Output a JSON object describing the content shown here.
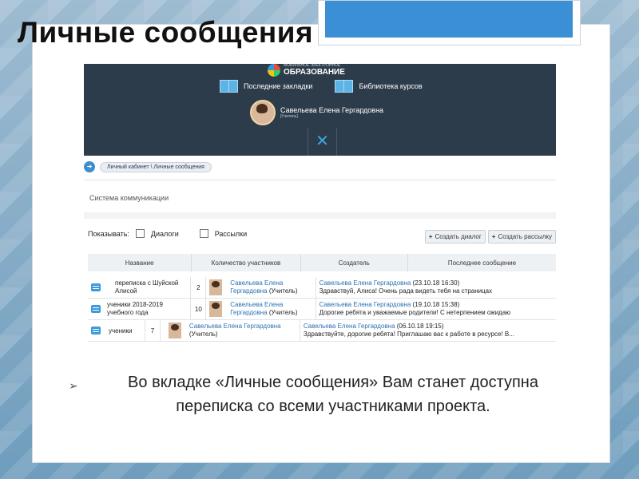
{
  "slide": {
    "title": "Личные сообщения",
    "bullet": "Во вкладке «Личные сообщения» Вам станет доступна переписка со всеми участниками проекта."
  },
  "app": {
    "logo_small": "МОБИЛЬНОЕ ЭЛЕКТРОННОЕ",
    "logo_main": "ОБРАЗОВАНИЕ",
    "nav": [
      {
        "label": "Последние закладки",
        "icon": "bookmarks-icon"
      },
      {
        "label": "Библиотека курсов",
        "icon": "library-icon"
      }
    ],
    "user": {
      "name": "Савельева Елена Гергардовна",
      "role": "[Учитель]"
    },
    "close_symbol": "✕",
    "breadcrumb": [
      "Личный кабинет",
      "Личные сообщения"
    ],
    "section_title": "Система коммуникации",
    "filter_label": "Показывать:",
    "filters": [
      "Диалоги",
      "Рассылки"
    ],
    "buttons": [
      "Создать диалог",
      "Создать рассылку"
    ],
    "columns": [
      "Название",
      "Количество участников",
      "Создатель",
      "Последнее сообщение"
    ],
    "rows": [
      {
        "name": "переписка с Шуйской Алисой",
        "count": "2",
        "creator": "Савельева Елена Гергардовна",
        "creator_role": "(Учитель)",
        "last_author": "Савельева Елена Гергардовна",
        "last_date": "(23.10.18 16:30)",
        "last_text": "Здравствуй, Алиса! Очень рада видеть тебя на страницах"
      },
      {
        "name": "ученики 2018-2019 учебного года",
        "count": "10",
        "creator": "Савельева Елена Гергардовна",
        "creator_role": "(Учитель)",
        "last_author": "Савельева Елена Гергардовна",
        "last_date": "(19.10.18 15:38)",
        "last_text": "Дорогие ребята и уважаемые родители! С нетерпением ожидаю"
      },
      {
        "name": "ученики",
        "count": "7",
        "creator": "Савельева Елена Гергардовна",
        "creator_role": "(Учитель)",
        "last_author": "Савельева Елена Гергардовна",
        "last_date": "(06.10.18 19:15)",
        "last_text": "Здравствуйте, дорогие ребята! Приглашаю вас к работе в ресурсе! В..."
      }
    ]
  },
  "colors": {
    "topbar": "#2d3c4b",
    "accent": "#3c9bd8",
    "link": "#2a72b5"
  }
}
